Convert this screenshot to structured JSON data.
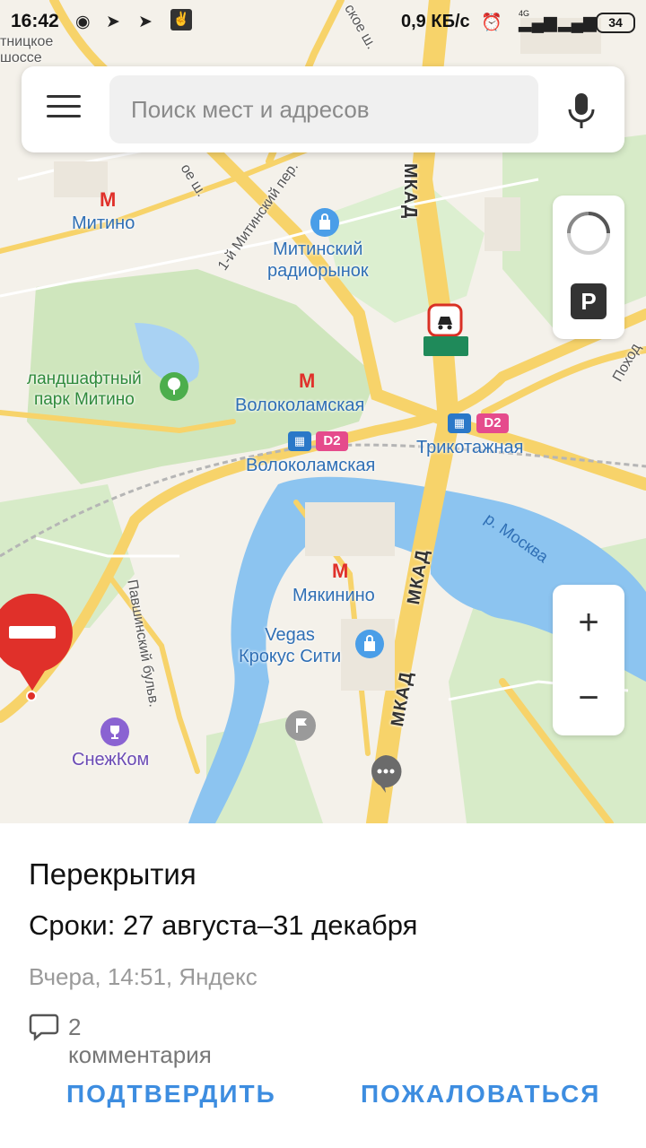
{
  "status_bar": {
    "time": "16:42",
    "network_speed": "0,9 КБ/с",
    "battery": "34",
    "network_type": "4G"
  },
  "search": {
    "placeholder": "Поиск мест и адресов"
  },
  "map": {
    "labels": {
      "mitino": "Митино",
      "mitinsky_market": "Митинский\nрадиорынок",
      "park_mitino": "ландшафтный\nпарк Митино",
      "volokolamskaya_metro": "Волоколамская",
      "volokolamskaya_rail": "Волоколамская",
      "trikotazhnaya": "Трикотажная",
      "myakinino": "Мякинино",
      "vegas": "Vegas\nКрокус Сити",
      "snezhkom": "СнежКом",
      "river": "р. Москва",
      "mkad_top": "МКАД",
      "mkad_middle": "МКАД",
      "mkad_bottom": "МКАД",
      "street_1mitinsky": "1-й Митинский пер.",
      "street_pyatnitskoe": "тницкое\nшоссе",
      "street_pavshinsky": "Павшинский бульв.",
      "street_mitinskoe": "ое ш.",
      "street_pokhod": "Поход",
      "street_top": "ское ш.",
      "d2_left": "D2",
      "d2_right": "D2",
      "parking": "P"
    }
  },
  "incident": {
    "title": "Перекрытия",
    "dates": "Сроки: 27 августа–31 декабря",
    "meta": "Вчера, 14:51, Яндекс",
    "comments": "2 комментария",
    "confirm_label": "ПОДТВЕРДИТЬ",
    "report_label": "ПОЖАЛОВАТЬСЯ"
  },
  "controls": {
    "zoom_in": "+",
    "zoom_out": "−"
  },
  "colors": {
    "accent": "#3d8de0",
    "closure_red": "#e0302a",
    "metro_red": "#e0302a",
    "road_yellow": "#f7d36a",
    "water": "#8cc4f0",
    "park_green": "#c8e6b4"
  }
}
